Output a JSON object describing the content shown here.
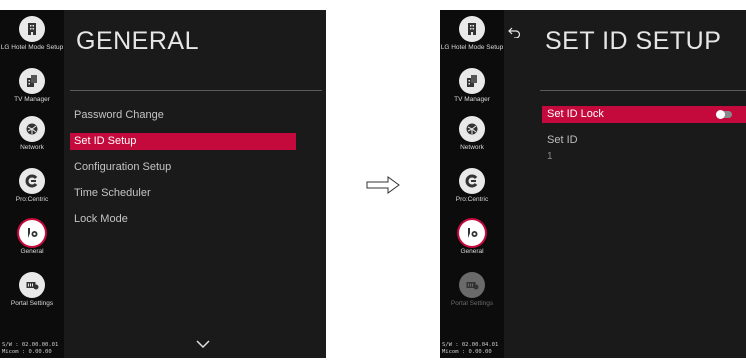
{
  "left_screen": {
    "sidebar": [
      {
        "label": "LG Hotel Mode Setup",
        "icon": "hotel-icon"
      },
      {
        "label": "TV Manager",
        "icon": "tv-manager-icon"
      },
      {
        "label": "Network",
        "icon": "network-icon"
      },
      {
        "label": "Pro:Centric",
        "icon": "procentric-icon"
      },
      {
        "label": "General",
        "icon": "general-icon"
      },
      {
        "label": "Portal Settings",
        "icon": "portal-icon"
      }
    ],
    "sw_info": {
      "sw": "S/W : 02.00.00.01",
      "micom": "Micom : 0.00.00"
    },
    "title": "GENERAL",
    "menu": [
      "Password Change",
      "Set ID Setup",
      "Configuration Setup",
      "Time Scheduler",
      "Lock Mode"
    ],
    "selected_menu_index": 1
  },
  "right_screen": {
    "sidebar": [
      {
        "label": "LG Hotel Mode Setup",
        "icon": "hotel-icon"
      },
      {
        "label": "TV Manager",
        "icon": "tv-manager-icon"
      },
      {
        "label": "Network",
        "icon": "network-icon"
      },
      {
        "label": "Pro:Centric",
        "icon": "procentric-icon"
      },
      {
        "label": "General",
        "icon": "general-icon"
      },
      {
        "label": "Portal Settings",
        "icon": "portal-icon"
      }
    ],
    "sw_info": {
      "sw": "S/W : 02.00.04.01",
      "micom": "Micom : 0.00.00"
    },
    "title": "SET ID SETUP",
    "set_id_lock": {
      "label": "Set ID Lock",
      "state": "off"
    },
    "set_id": {
      "label": "Set ID",
      "value": "1"
    }
  },
  "colors": {
    "accent": "#c40a3d",
    "panel": "#1a1a1a",
    "sidebar": "#0c0c0c"
  }
}
